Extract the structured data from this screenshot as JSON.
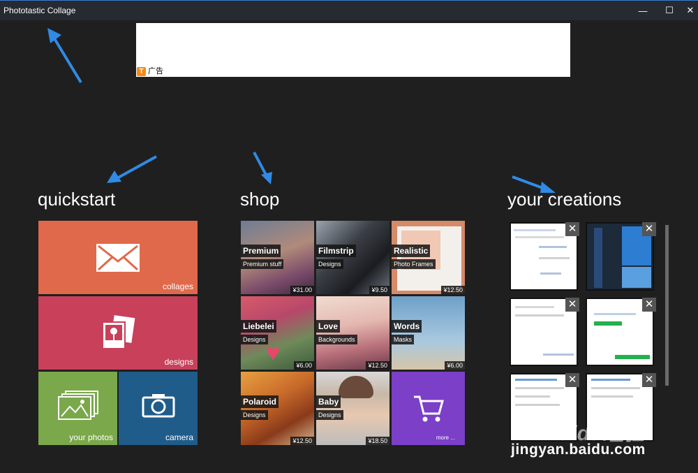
{
  "window": {
    "title": "Phototastic Collage",
    "minimize_glyph": "—",
    "maximize_glyph": "☐",
    "close_glyph": "✕"
  },
  "ad": {
    "badge": "T",
    "label": "广告"
  },
  "quickstart": {
    "title": "quickstart",
    "tiles": [
      {
        "label": "collages",
        "icon": "envelope-icon",
        "color": "#e0694b"
      },
      {
        "label": "designs",
        "icon": "photo-cards-icon",
        "color": "#c8405a"
      },
      {
        "label": "your photos",
        "icon": "photo-stack-icon",
        "color": "#7aa84a"
      },
      {
        "label": "camera",
        "icon": "camera-icon",
        "color": "#1f5c8a"
      }
    ]
  },
  "shop": {
    "title": "shop",
    "items": [
      {
        "name": "Premium",
        "subtitle": "Premium stuff",
        "price": "¥31.00"
      },
      {
        "name": "Filmstrip",
        "subtitle": "Designs",
        "price": "¥9.50"
      },
      {
        "name": "Realistic",
        "subtitle": "Photo Frames",
        "price": "¥12.50"
      },
      {
        "name": "Liebelei",
        "subtitle": "Designs",
        "price": "¥6.00"
      },
      {
        "name": "Love",
        "subtitle": "Backgrounds",
        "price": "¥12.50"
      },
      {
        "name": "Words",
        "subtitle": "Masks",
        "price": "¥6.00"
      },
      {
        "name": "Polaroid",
        "subtitle": "Designs",
        "price": "¥12.50"
      },
      {
        "name": "Baby",
        "subtitle": "Designs",
        "price": "¥18.50"
      }
    ],
    "more_label": "more ...",
    "more_icon": "shopping-cart-icon"
  },
  "creations": {
    "title": "your creations",
    "close_glyph": "✕",
    "count": 6
  },
  "watermark": {
    "text": "jingyan.baidu.com",
    "logo": "Baidu经验"
  },
  "colors": {
    "background": "#1f1f1f",
    "titlebar": "#262a31",
    "accent_arrow": "#2f8be6"
  }
}
